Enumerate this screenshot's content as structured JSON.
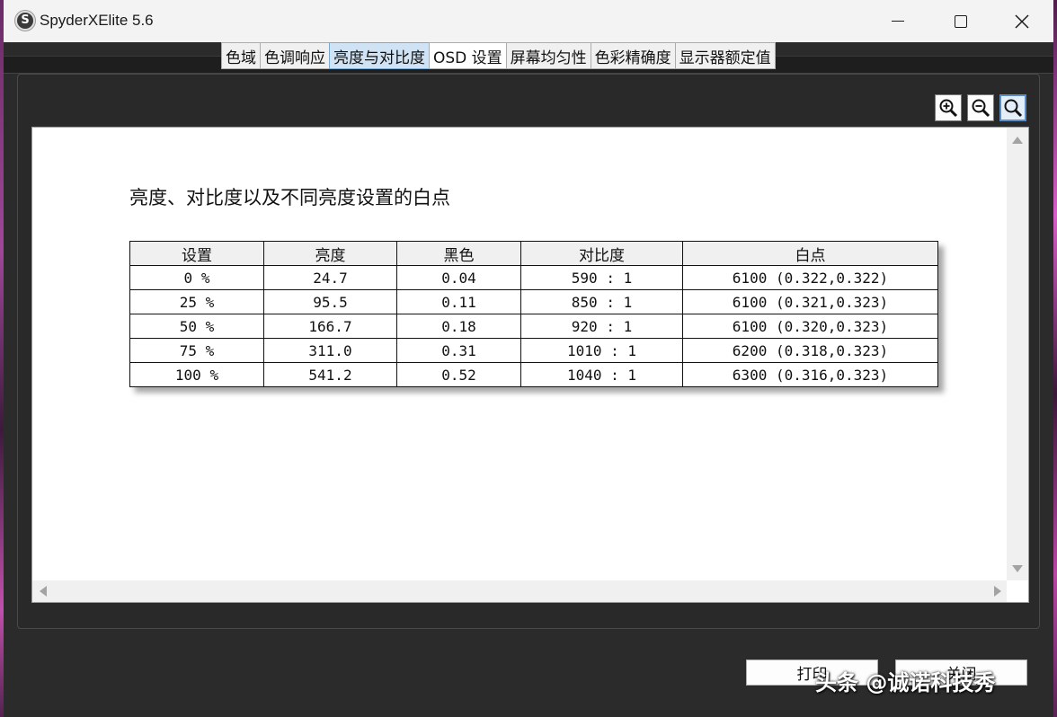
{
  "window": {
    "title": "SpyderXElite 5.6",
    "icon_letter": "S"
  },
  "tabs": [
    {
      "label": "色域"
    },
    {
      "label": "色调响应"
    },
    {
      "label": "亮度与对比度",
      "active": true
    },
    {
      "label": "OSD 设置"
    },
    {
      "label": "屏幕均匀性"
    },
    {
      "label": "色彩精确度"
    },
    {
      "label": "显示器额定值"
    }
  ],
  "zoom": {
    "icons": [
      "zoom-in-icon",
      "zoom-out-icon",
      "zoom-fit-icon"
    ]
  },
  "report": {
    "title": "亮度、对比度以及不同亮度设置的白点",
    "columns": [
      "设置",
      "亮度",
      "黑色",
      "对比度",
      "白点"
    ],
    "rows": [
      [
        "0 %",
        "24.7",
        "0.04",
        "590 : 1",
        "6100 (0.322,0.322)"
      ],
      [
        "25 %",
        "95.5",
        "0.11",
        "850 : 1",
        "6100 (0.321,0.323)"
      ],
      [
        "50 %",
        "166.7",
        "0.18",
        "920 : 1",
        "6100 (0.320,0.323)"
      ],
      [
        "75 %",
        "311.0",
        "0.31",
        "1010 : 1",
        "6200 (0.318,0.323)"
      ],
      [
        "100 %",
        "541.2",
        "0.52",
        "1040 : 1",
        "6300 (0.316,0.323)"
      ]
    ]
  },
  "buttons": {
    "print": "打印",
    "close": "关闭"
  },
  "watermark": "头条 @诚诺科技秀",
  "colors": {
    "active_tab": "#cfe3f5",
    "panel_bg": "#292929",
    "title_bar": "#f3f3f3"
  }
}
